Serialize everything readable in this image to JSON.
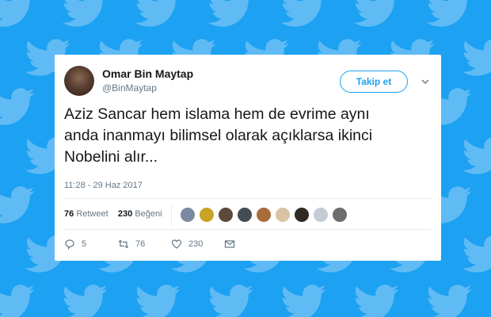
{
  "user": {
    "name": "Omar Bin Maytap",
    "handle": "@BinMaytap",
    "avatar_icon": "avatar-icon"
  },
  "follow_button": {
    "label": "Takip et"
  },
  "more_icon": "chevron-down-icon",
  "tweet": {
    "line1": "Aziz Sancar hem islama hem de evrime aynı",
    "line2": "anda inanmayı bilimsel olarak açıklarsa ikinci",
    "line3": "Nobelini alır...",
    "timestamp": "11:28 - 29 Haz 2017"
  },
  "stats": {
    "retweets_count": "76",
    "retweets_label": "Retweet",
    "likes_count": "230",
    "likes_label": "Beğeni"
  },
  "actions": {
    "reply_count": "5",
    "retweet_count": "76",
    "like_count": "230"
  },
  "colors": {
    "brand": "#1da1f2",
    "text": "#14171a",
    "muted": "#657786",
    "background": "#1da1f2"
  }
}
